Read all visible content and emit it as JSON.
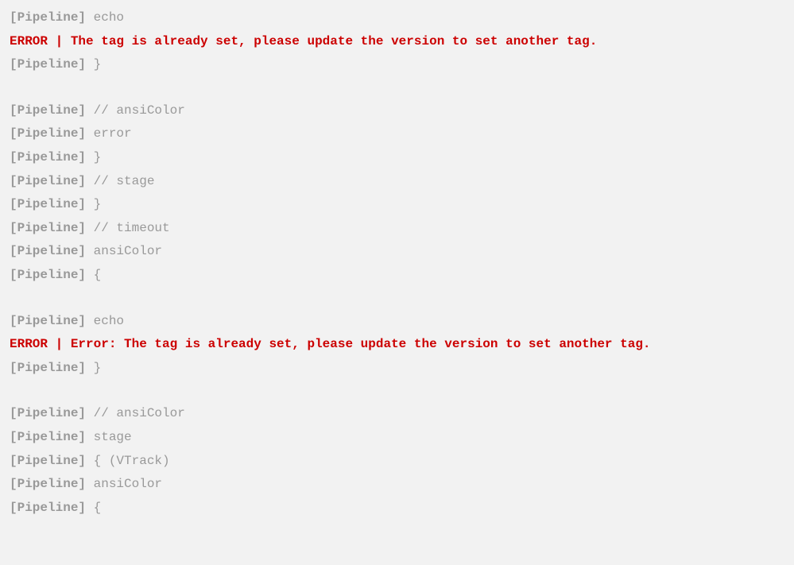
{
  "log": {
    "lines": [
      {
        "type": "pipe",
        "prefix": "[Pipeline]",
        "text": " echo"
      },
      {
        "type": "error",
        "text": "ERROR | The tag is already set, please update the version to set another tag."
      },
      {
        "type": "pipe",
        "prefix": "[Pipeline]",
        "text": " }"
      },
      {
        "type": "blank"
      },
      {
        "type": "pipe",
        "prefix": "[Pipeline]",
        "text": " // ansiColor"
      },
      {
        "type": "pipe",
        "prefix": "[Pipeline]",
        "text": " error"
      },
      {
        "type": "pipe",
        "prefix": "[Pipeline]",
        "text": " }"
      },
      {
        "type": "pipe",
        "prefix": "[Pipeline]",
        "text": " // stage"
      },
      {
        "type": "pipe",
        "prefix": "[Pipeline]",
        "text": " }"
      },
      {
        "type": "pipe",
        "prefix": "[Pipeline]",
        "text": " // timeout"
      },
      {
        "type": "pipe",
        "prefix": "[Pipeline]",
        "text": " ansiColor"
      },
      {
        "type": "pipe",
        "prefix": "[Pipeline]",
        "text": " {"
      },
      {
        "type": "blank"
      },
      {
        "type": "pipe",
        "prefix": "[Pipeline]",
        "text": " echo"
      },
      {
        "type": "error",
        "text": "ERROR | Error: The tag is already set, please update the version to set another tag."
      },
      {
        "type": "pipe",
        "prefix": "[Pipeline]",
        "text": " }"
      },
      {
        "type": "blank"
      },
      {
        "type": "pipe",
        "prefix": "[Pipeline]",
        "text": " // ansiColor"
      },
      {
        "type": "pipe",
        "prefix": "[Pipeline]",
        "text": " stage"
      },
      {
        "type": "pipe",
        "prefix": "[Pipeline]",
        "text": " { (VTrack)"
      },
      {
        "type": "pipe",
        "prefix": "[Pipeline]",
        "text": " ansiColor"
      },
      {
        "type": "pipe",
        "prefix": "[Pipeline]",
        "text": " {"
      }
    ]
  }
}
